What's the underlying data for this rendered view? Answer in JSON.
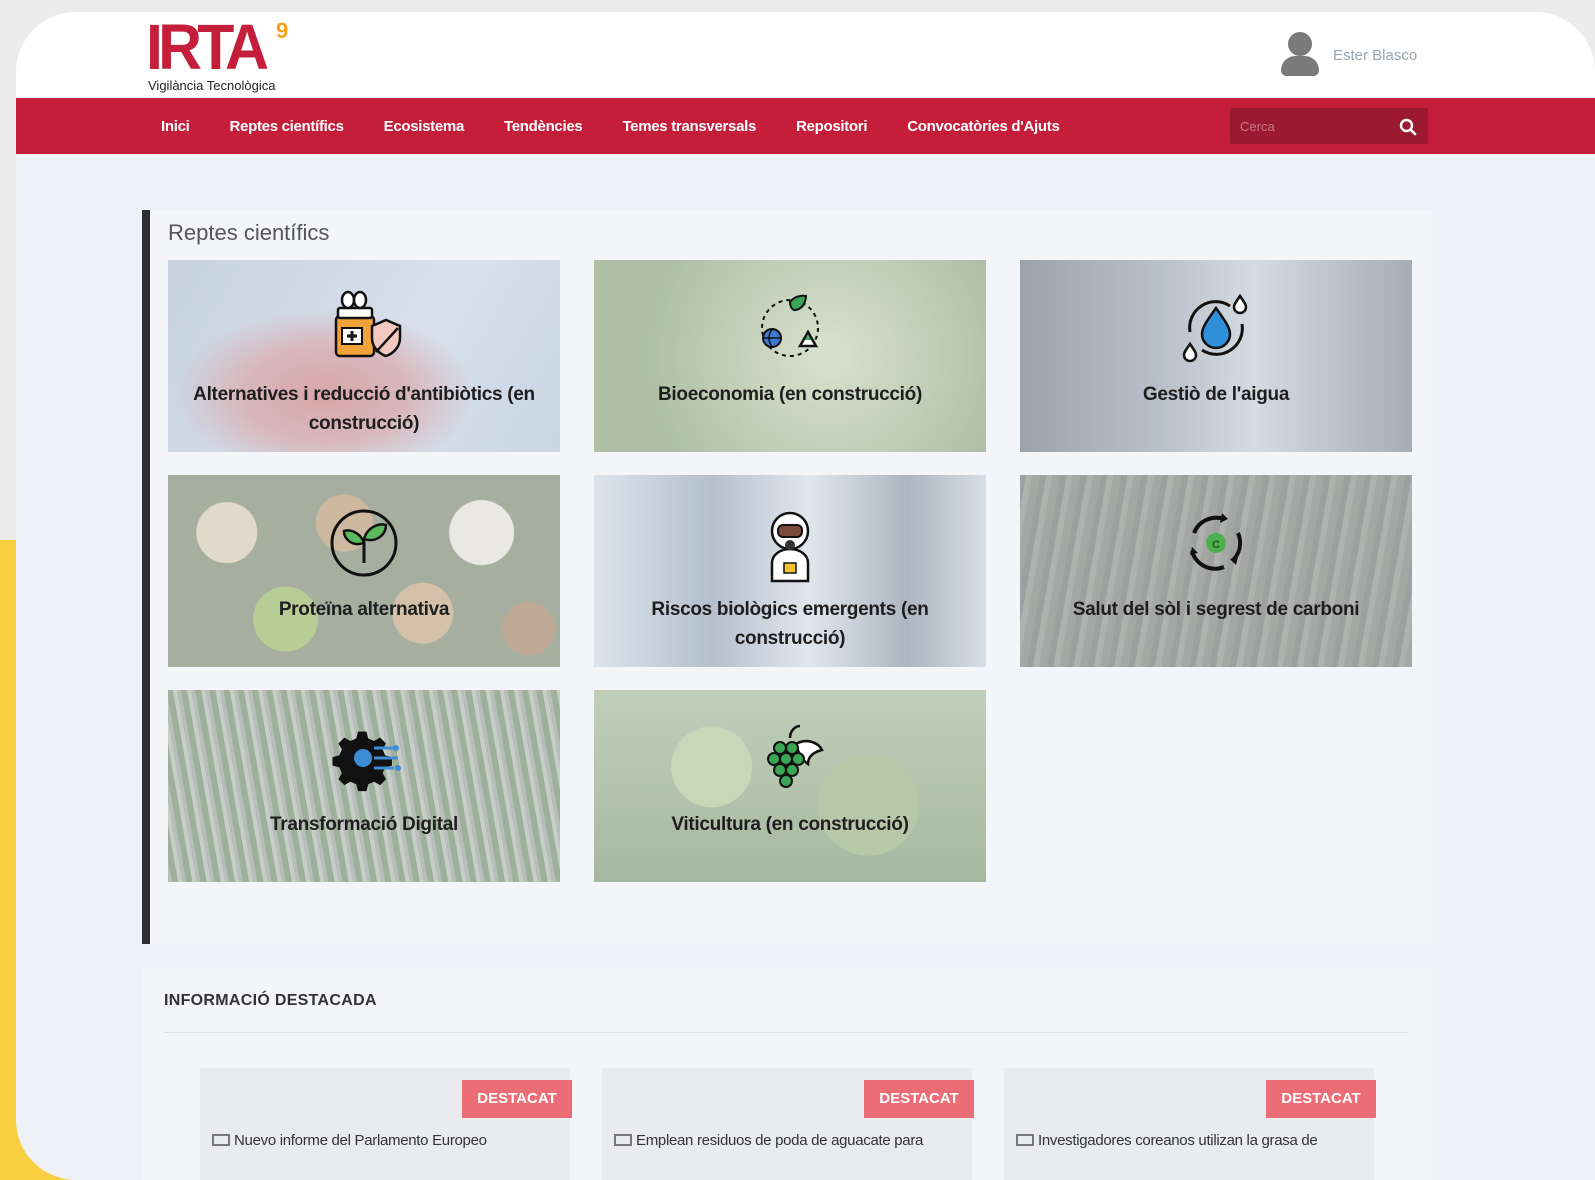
{
  "header": {
    "logo_text": "IRTA",
    "logo_mark": "9",
    "logo_subtitle": "Vigilància Tecnològica",
    "user_name": "Ester Blasco"
  },
  "nav": {
    "items": [
      "Inici",
      "Reptes científics",
      "Ecosistema",
      "Tendències",
      "Temes transversals",
      "Repositori",
      "Convocatòries d'Ajuts"
    ],
    "search_placeholder": "Cerca"
  },
  "reptes": {
    "title": "Reptes científics",
    "tiles": [
      {
        "label": "Alternatives i reducció d'antibiòtics (en construcció)",
        "icon": "medicine-shield-icon"
      },
      {
        "label": "Bioeconomia (en construcció)",
        "icon": "bioeconomy-cycle-icon"
      },
      {
        "label": "Gestiò de l'aigua",
        "icon": "water-drop-icon"
      },
      {
        "label": "Proteïna alternativa",
        "icon": "sprout-icon"
      },
      {
        "label": "Riscos biològics emergents (en construcció)",
        "icon": "hazmat-suit-icon"
      },
      {
        "label": "Salut del sòl i segrest de carboni",
        "icon": "soil-cycle-icon"
      },
      {
        "label": "Transformació Digital",
        "icon": "digital-gear-icon"
      },
      {
        "label": "Viticultura (en construcció)",
        "icon": "grapes-icon"
      }
    ]
  },
  "info": {
    "title": "INFORMACIÓ DESTACADA",
    "cards": [
      {
        "badge": "DESTACAT",
        "text": "Nuevo informe del Parlamento Europeo"
      },
      {
        "badge": "DESTACAT",
        "text": "Emplean residuos de poda de aguacate para"
      },
      {
        "badge": "DESTACAT",
        "text": "Investigadores coreanos utilizan la grasa de"
      }
    ]
  },
  "colors": {
    "brand_red": "#c41e3a",
    "badge_red": "#ec6d76",
    "accent_yellow": "#f8cf3f"
  }
}
